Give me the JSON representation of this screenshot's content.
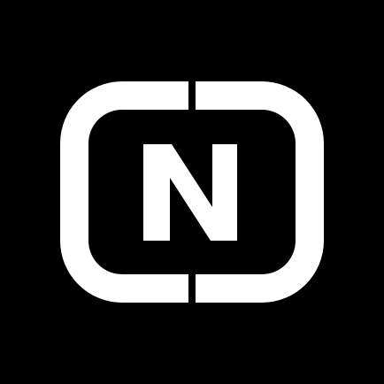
{
  "icon": {
    "name": "n-logo-icon",
    "letter": "N",
    "foreground_color": "#FFFFFF",
    "background_color": "#000000"
  }
}
